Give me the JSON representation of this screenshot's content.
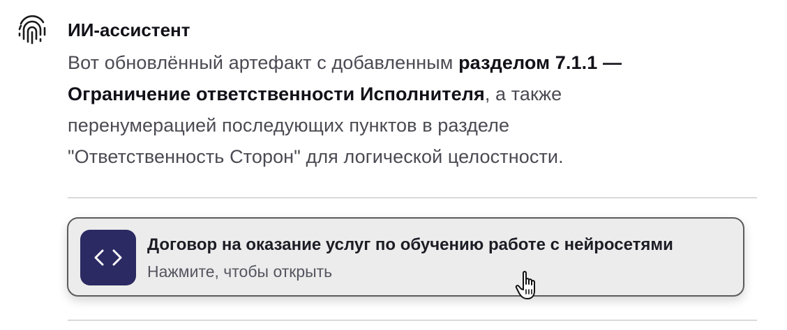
{
  "assistant": {
    "name": "ИИ-ассистент",
    "icon": "fingerprint-icon",
    "message": {
      "line1_text": "Вот обновлённый артефакт с добавленным ",
      "line1_bold": "разделом 7.1.1 —",
      "line2_bold": "Ограничение ответственности Исполнителя",
      "line2_text": ", а также",
      "line3_text": "перенумерацией последующих пунктов в разделе",
      "line4_text": "\"Ответственность Сторон\" для логической целостности."
    }
  },
  "artifact": {
    "icon": "code-icon",
    "icon_color": "#2c2a62",
    "title": "Договор на оказание услуг по обучению работе с нейросетями",
    "subtitle": "Нажмите, чтобы открыть"
  },
  "cursor": {
    "icon": "hand-pointer-icon"
  }
}
